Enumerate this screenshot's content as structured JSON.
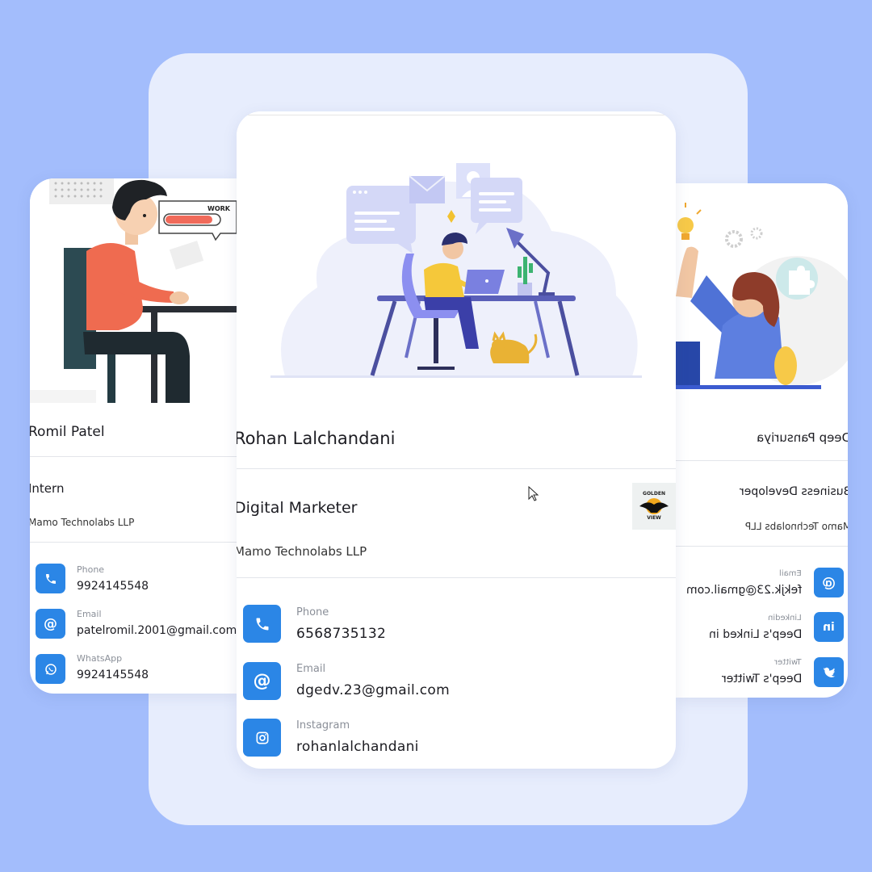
{
  "colors": {
    "background": "#a3bdfc",
    "panel": "#e7edfd",
    "icon_accent": "#2b86e6"
  },
  "cards": {
    "left": {
      "name": "Romil Patel",
      "title": "Intern",
      "company": "Mamo Technolabs LLP",
      "illustration_text": "WORK",
      "contacts": [
        {
          "icon": "phone-icon",
          "label": "Phone",
          "value": "9924145548"
        },
        {
          "icon": "email-icon",
          "label": "Email",
          "value": "patelromil.2001@gmail.com"
        },
        {
          "icon": "whatsapp-icon",
          "label": "WhatsApp",
          "value": "9924145548"
        }
      ]
    },
    "center": {
      "name": "Rohan Lalchandani",
      "title": "Digital Marketer",
      "company": "Mamo Technolabs LLP",
      "logo_text_top": "GOLDEN",
      "logo_text_bottom": "VIEW",
      "contacts": [
        {
          "icon": "phone-icon",
          "label": "Phone",
          "value": "6568735132"
        },
        {
          "icon": "email-icon",
          "label": "Email",
          "value": "dgedv.23@gmail.com"
        },
        {
          "icon": "instagram-icon",
          "label": "Instagram",
          "value": "rohanlalchandani"
        }
      ]
    },
    "right": {
      "name": "Deep Pansuriya",
      "title": "Business Developer",
      "company": "Mamo Technolabs LLP",
      "contacts": [
        {
          "icon": "email-icon",
          "label": "Email",
          "value": "fekjk.23@gmail.com"
        },
        {
          "icon": "linkedin-icon",
          "label": "Linkedin",
          "value": "Deep's Linked in"
        },
        {
          "icon": "twitter-icon",
          "label": "Twitter",
          "value": "Deep's Twitter"
        }
      ]
    }
  }
}
